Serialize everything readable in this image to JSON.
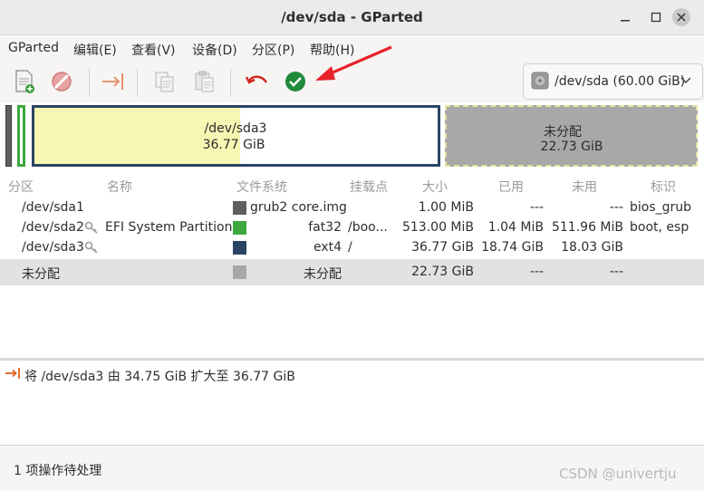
{
  "window": {
    "title": "/dev/sda - GParted"
  },
  "menu": [
    "GParted",
    "编辑(E)",
    "查看(V)",
    "设备(D)",
    "分区(P)",
    "帮助(H)"
  ],
  "toolbar": {
    "icons": [
      "new-partition-icon",
      "delete-icon",
      "resize-move-icon",
      "copy-icon",
      "paste-icon",
      "undo-icon",
      "apply-icon"
    ],
    "device_selector": "/dev/sda (60.00 GiB)"
  },
  "graph": {
    "sda3": {
      "name": "/dev/sda3",
      "size": "36.77 GiB",
      "used_fraction": 0.51
    },
    "unallocated": {
      "name": "未分配",
      "size": "22.73 GiB"
    }
  },
  "table": {
    "columns": [
      "分区",
      "名称",
      "文件系统",
      "挂载点",
      "大小",
      "已用",
      "未用",
      "标识"
    ],
    "rows": [
      {
        "partition": "/dev/sda1",
        "name": "",
        "fs": "grub2 core.img",
        "fs_color": "#5f5f5f",
        "mount": "",
        "size": "1.00 MiB",
        "used": "---",
        "unused": "---",
        "flags": "bios_grub",
        "key": false
      },
      {
        "partition": "/dev/sda2",
        "name": "EFI System Partition",
        "fs": "fat32",
        "fs_color": "#3ea83e",
        "mount": "/boo...",
        "size": "513.00 MiB",
        "used": "1.04 MiB",
        "unused": "511.96 MiB",
        "flags": "boot, esp",
        "key": true
      },
      {
        "partition": "/dev/sda3",
        "name": "",
        "fs": "ext4",
        "fs_color": "#2c4463",
        "mount": "/",
        "size": "36.77 GiB",
        "used": "18.74 GiB",
        "unused": "18.03 GiB",
        "flags": "",
        "key": true
      },
      {
        "partition": "未分配",
        "name": "",
        "fs": "未分配",
        "fs_color": "#a8a8a8",
        "mount": "",
        "size": "22.73 GiB",
        "used": "---",
        "unused": "---",
        "flags": "",
        "key": false
      }
    ]
  },
  "operations": [
    "将 /dev/sda3 由 34.75 GiB 扩大至 36.77 GiB"
  ],
  "status": {
    "pending": "1 项操作待处理"
  },
  "watermark": "CSDN @univertju",
  "colors": {
    "annotation_arrow": "#e8222b",
    "apply_green": "#1e8a3a",
    "undo_red": "#d2261a",
    "resize_orange": "#e35b1e"
  }
}
